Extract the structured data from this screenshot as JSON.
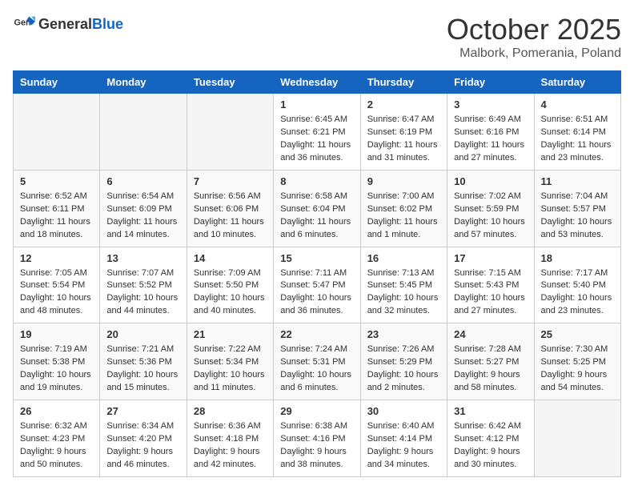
{
  "header": {
    "logo_general": "General",
    "logo_blue": "Blue",
    "month": "October 2025",
    "location": "Malbork, Pomerania, Poland"
  },
  "days_of_week": [
    "Sunday",
    "Monday",
    "Tuesday",
    "Wednesday",
    "Thursday",
    "Friday",
    "Saturday"
  ],
  "weeks": [
    [
      {
        "day": "",
        "info": ""
      },
      {
        "day": "",
        "info": ""
      },
      {
        "day": "",
        "info": ""
      },
      {
        "day": "1",
        "info": "Sunrise: 6:45 AM\nSunset: 6:21 PM\nDaylight: 11 hours\nand 36 minutes."
      },
      {
        "day": "2",
        "info": "Sunrise: 6:47 AM\nSunset: 6:19 PM\nDaylight: 11 hours\nand 31 minutes."
      },
      {
        "day": "3",
        "info": "Sunrise: 6:49 AM\nSunset: 6:16 PM\nDaylight: 11 hours\nand 27 minutes."
      },
      {
        "day": "4",
        "info": "Sunrise: 6:51 AM\nSunset: 6:14 PM\nDaylight: 11 hours\nand 23 minutes."
      }
    ],
    [
      {
        "day": "5",
        "info": "Sunrise: 6:52 AM\nSunset: 6:11 PM\nDaylight: 11 hours\nand 18 minutes."
      },
      {
        "day": "6",
        "info": "Sunrise: 6:54 AM\nSunset: 6:09 PM\nDaylight: 11 hours\nand 14 minutes."
      },
      {
        "day": "7",
        "info": "Sunrise: 6:56 AM\nSunset: 6:06 PM\nDaylight: 11 hours\nand 10 minutes."
      },
      {
        "day": "8",
        "info": "Sunrise: 6:58 AM\nSunset: 6:04 PM\nDaylight: 11 hours\nand 6 minutes."
      },
      {
        "day": "9",
        "info": "Sunrise: 7:00 AM\nSunset: 6:02 PM\nDaylight: 11 hours\nand 1 minute."
      },
      {
        "day": "10",
        "info": "Sunrise: 7:02 AM\nSunset: 5:59 PM\nDaylight: 10 hours\nand 57 minutes."
      },
      {
        "day": "11",
        "info": "Sunrise: 7:04 AM\nSunset: 5:57 PM\nDaylight: 10 hours\nand 53 minutes."
      }
    ],
    [
      {
        "day": "12",
        "info": "Sunrise: 7:05 AM\nSunset: 5:54 PM\nDaylight: 10 hours\nand 48 minutes."
      },
      {
        "day": "13",
        "info": "Sunrise: 7:07 AM\nSunset: 5:52 PM\nDaylight: 10 hours\nand 44 minutes."
      },
      {
        "day": "14",
        "info": "Sunrise: 7:09 AM\nSunset: 5:50 PM\nDaylight: 10 hours\nand 40 minutes."
      },
      {
        "day": "15",
        "info": "Sunrise: 7:11 AM\nSunset: 5:47 PM\nDaylight: 10 hours\nand 36 minutes."
      },
      {
        "day": "16",
        "info": "Sunrise: 7:13 AM\nSunset: 5:45 PM\nDaylight: 10 hours\nand 32 minutes."
      },
      {
        "day": "17",
        "info": "Sunrise: 7:15 AM\nSunset: 5:43 PM\nDaylight: 10 hours\nand 27 minutes."
      },
      {
        "day": "18",
        "info": "Sunrise: 7:17 AM\nSunset: 5:40 PM\nDaylight: 10 hours\nand 23 minutes."
      }
    ],
    [
      {
        "day": "19",
        "info": "Sunrise: 7:19 AM\nSunset: 5:38 PM\nDaylight: 10 hours\nand 19 minutes."
      },
      {
        "day": "20",
        "info": "Sunrise: 7:21 AM\nSunset: 5:36 PM\nDaylight: 10 hours\nand 15 minutes."
      },
      {
        "day": "21",
        "info": "Sunrise: 7:22 AM\nSunset: 5:34 PM\nDaylight: 10 hours\nand 11 minutes."
      },
      {
        "day": "22",
        "info": "Sunrise: 7:24 AM\nSunset: 5:31 PM\nDaylight: 10 hours\nand 6 minutes."
      },
      {
        "day": "23",
        "info": "Sunrise: 7:26 AM\nSunset: 5:29 PM\nDaylight: 10 hours\nand 2 minutes."
      },
      {
        "day": "24",
        "info": "Sunrise: 7:28 AM\nSunset: 5:27 PM\nDaylight: 9 hours\nand 58 minutes."
      },
      {
        "day": "25",
        "info": "Sunrise: 7:30 AM\nSunset: 5:25 PM\nDaylight: 9 hours\nand 54 minutes."
      }
    ],
    [
      {
        "day": "26",
        "info": "Sunrise: 6:32 AM\nSunset: 4:23 PM\nDaylight: 9 hours\nand 50 minutes."
      },
      {
        "day": "27",
        "info": "Sunrise: 6:34 AM\nSunset: 4:20 PM\nDaylight: 9 hours\nand 46 minutes."
      },
      {
        "day": "28",
        "info": "Sunrise: 6:36 AM\nSunset: 4:18 PM\nDaylight: 9 hours\nand 42 minutes."
      },
      {
        "day": "29",
        "info": "Sunrise: 6:38 AM\nSunset: 4:16 PM\nDaylight: 9 hours\nand 38 minutes."
      },
      {
        "day": "30",
        "info": "Sunrise: 6:40 AM\nSunset: 4:14 PM\nDaylight: 9 hours\nand 34 minutes."
      },
      {
        "day": "31",
        "info": "Sunrise: 6:42 AM\nSunset: 4:12 PM\nDaylight: 9 hours\nand 30 minutes."
      },
      {
        "day": "",
        "info": ""
      }
    ]
  ]
}
